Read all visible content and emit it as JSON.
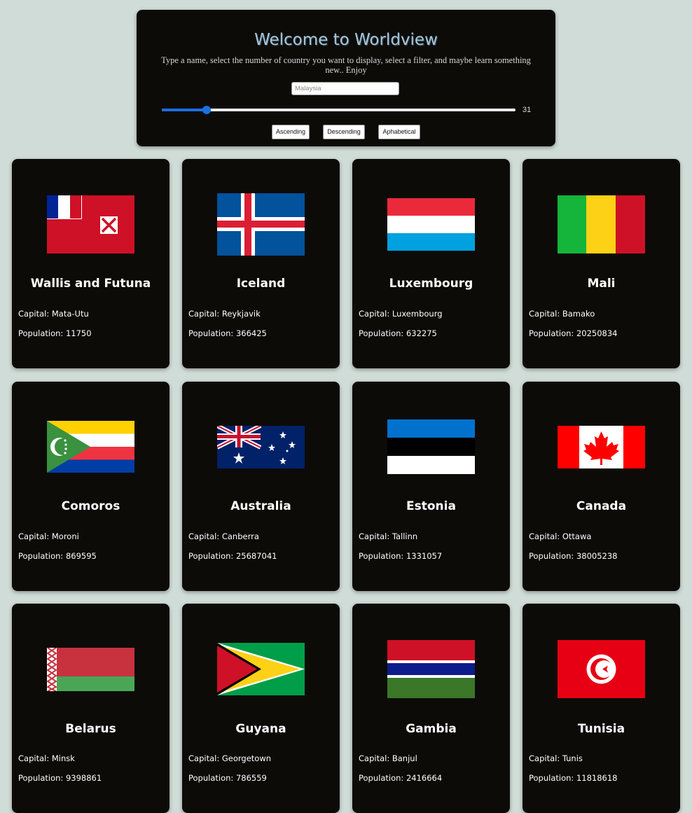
{
  "header": {
    "title": "Welcome to Worldview",
    "description": "Type a name, select the number of country you want to display, select a filter, and maybe learn something new.. Enjoy",
    "search_placeholder": "Malaysia",
    "slider_value": 31,
    "buttons": [
      "Ascending",
      "Descending",
      "Aphabetical"
    ]
  },
  "labels": {
    "capital": "Capital: ",
    "population": "Population: "
  },
  "countries": [
    {
      "name": "Wallis and Futuna",
      "capital": "Mata-Utu",
      "population": "11750"
    },
    {
      "name": "Iceland",
      "capital": "Reykjavik",
      "population": "366425"
    },
    {
      "name": "Luxembourg",
      "capital": "Luxembourg",
      "population": "632275"
    },
    {
      "name": "Mali",
      "capital": "Bamako",
      "population": "20250834"
    },
    {
      "name": "Comoros",
      "capital": "Moroni",
      "population": "869595"
    },
    {
      "name": "Australia",
      "capital": "Canberra",
      "population": "25687041"
    },
    {
      "name": "Estonia",
      "capital": "Tallinn",
      "population": "1331057"
    },
    {
      "name": "Canada",
      "capital": "Ottawa",
      "population": "38005238"
    },
    {
      "name": "Belarus",
      "capital": "Minsk",
      "population": "9398861"
    },
    {
      "name": "Guyana",
      "capital": "Georgetown",
      "population": "786559"
    },
    {
      "name": "Gambia",
      "capital": "Banjul",
      "population": "2416664"
    },
    {
      "name": "Tunisia",
      "capital": "Tunis",
      "population": "11818618"
    }
  ],
  "colors": {
    "background": "#d0dcd7",
    "card": "#0c0b08",
    "accent": "#1d6ee0",
    "title": "#a6c5d8"
  }
}
